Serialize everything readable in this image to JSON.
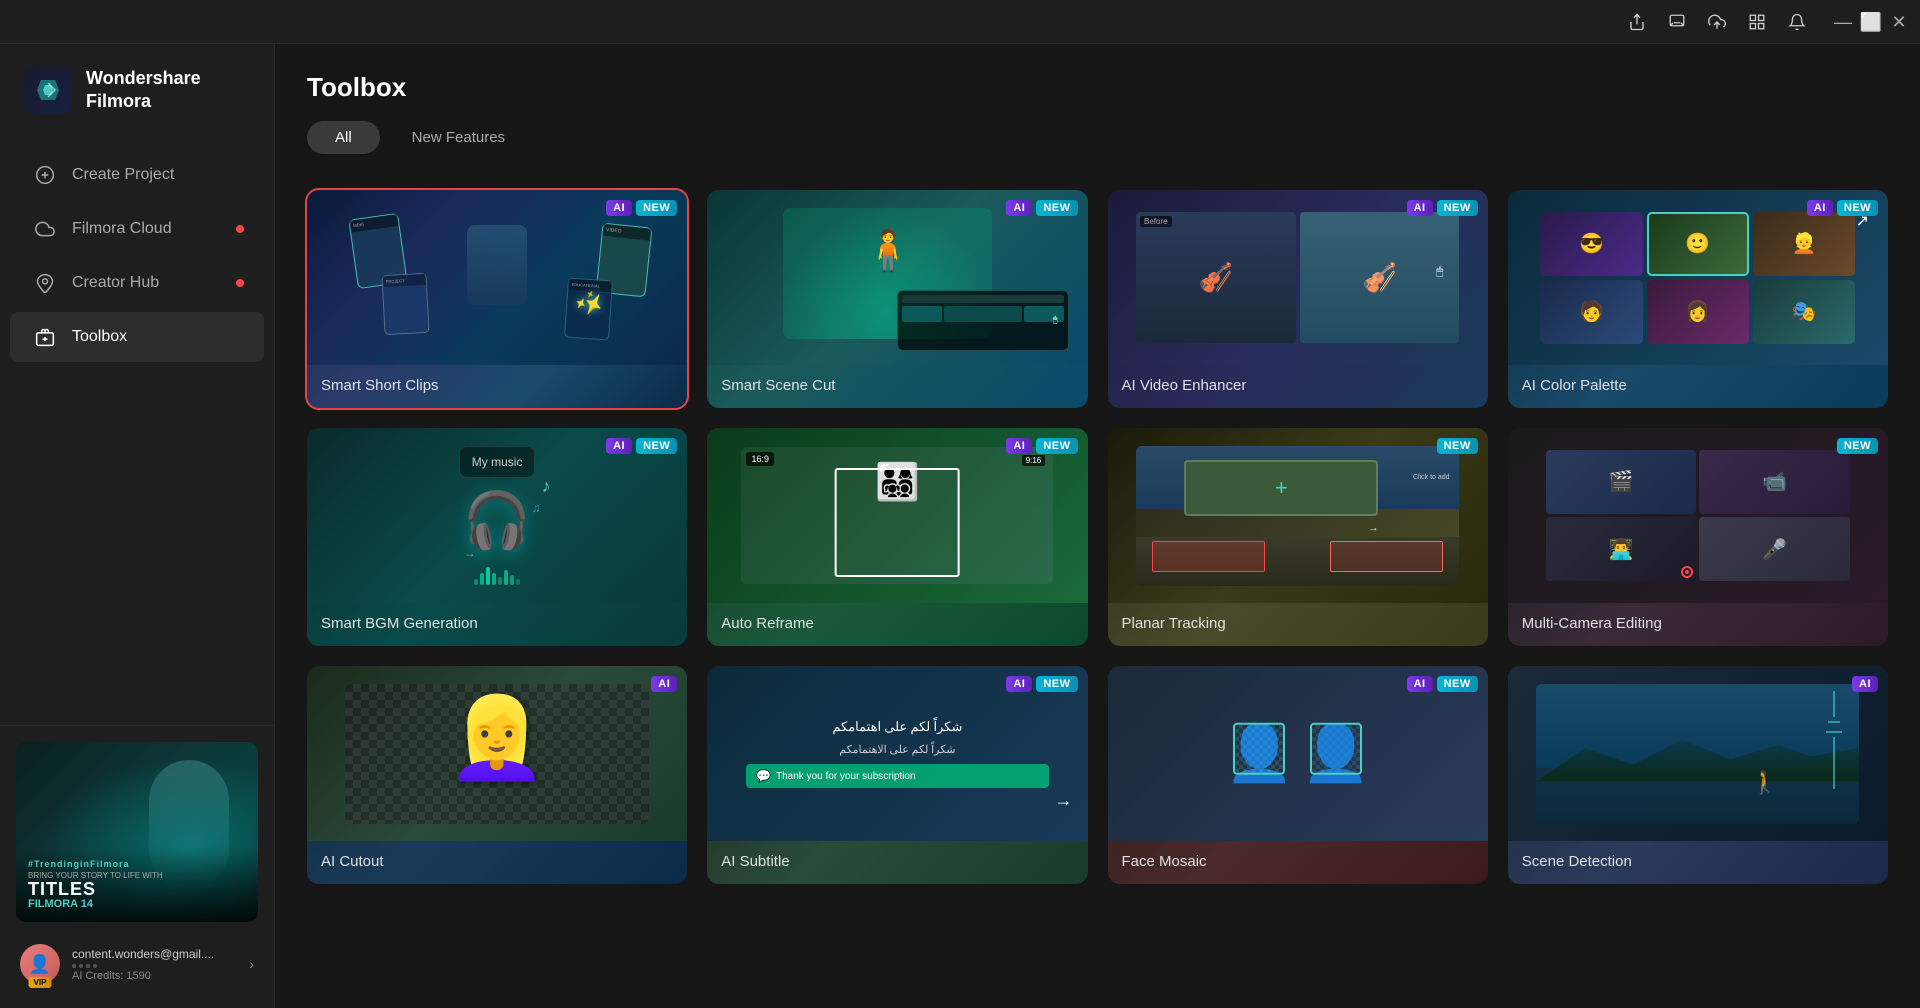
{
  "app": {
    "name": "Wondershare Filmora",
    "logo_text_line1": "Wondershare",
    "logo_text_line2": "Filmora"
  },
  "titlebar": {
    "icons": [
      "share",
      "feedback",
      "upload",
      "grid",
      "notifications",
      "minimize",
      "maximize",
      "close"
    ]
  },
  "sidebar": {
    "nav_items": [
      {
        "id": "create-project",
        "label": "Create Project",
        "icon": "➕",
        "active": false,
        "dot": false
      },
      {
        "id": "filmora-cloud",
        "label": "Filmora Cloud",
        "icon": "☁",
        "active": false,
        "dot": true
      },
      {
        "id": "creator-hub",
        "label": "Creator Hub",
        "icon": "📍",
        "active": false,
        "dot": true
      },
      {
        "id": "toolbox",
        "label": "Toolbox",
        "icon": "🧰",
        "active": true,
        "dot": false
      }
    ],
    "promo": {
      "tag": "#TrendinginFilmora",
      "subtitle": "BRING YOUR STORY TO LIFE WITH",
      "title": "TITLES",
      "label": "FILMORA 14"
    },
    "user": {
      "email": "content.wonders@gmail....",
      "credits_label": "AI Credits: 1590",
      "vip": "VIP"
    }
  },
  "content": {
    "title": "Toolbox",
    "tabs": [
      {
        "id": "all",
        "label": "All",
        "active": true
      },
      {
        "id": "new-features",
        "label": "New Features",
        "active": false
      }
    ],
    "tools": [
      {
        "id": "smart-short-clips",
        "name": "Smart Short Clips",
        "badges": [
          "AI",
          "NEW"
        ],
        "bg_class": "card-bg-1",
        "selected": true,
        "visual_type": "ssc"
      },
      {
        "id": "smart-scene-cut",
        "name": "Smart Scene Cut",
        "badges": [
          "AI",
          "NEW"
        ],
        "bg_class": "card-bg-2",
        "selected": false,
        "visual_type": "scene_cut"
      },
      {
        "id": "ai-video-enhancer",
        "name": "AI Video Enhancer",
        "badges": [
          "AI",
          "NEW"
        ],
        "bg_class": "card-bg-3",
        "selected": false,
        "visual_type": "aiv"
      },
      {
        "id": "ai-color-palette",
        "name": "AI Color Palette",
        "badges": [
          "AI",
          "NEW"
        ],
        "bg_class": "card-bg-4",
        "selected": false,
        "visual_type": "acp"
      },
      {
        "id": "smart-bgm-generation",
        "name": "Smart BGM Generation",
        "badges": [
          "AI",
          "NEW"
        ],
        "bg_class": "card-bg-5",
        "selected": false,
        "visual_type": "bgm"
      },
      {
        "id": "auto-reframe",
        "name": "Auto Reframe",
        "badges": [
          "AI",
          "NEW"
        ],
        "bg_class": "card-bg-6",
        "selected": false,
        "visual_type": "ar"
      },
      {
        "id": "planar-tracking",
        "name": "Planar Tracking",
        "badges": [
          "NEW"
        ],
        "bg_class": "card-bg-7",
        "selected": false,
        "visual_type": "pt"
      },
      {
        "id": "multi-camera-editing",
        "name": "Multi-Camera Editing",
        "badges": [
          "NEW"
        ],
        "bg_class": "card-bg-8",
        "selected": false,
        "visual_type": "mc"
      },
      {
        "id": "ai-cutout",
        "name": "AI Cutout",
        "badges": [
          "AI"
        ],
        "bg_class": "card-bg-9",
        "selected": false,
        "visual_type": "person"
      },
      {
        "id": "ai-subtitle",
        "name": "AI Subtitle",
        "badges": [
          "AI",
          "NEW"
        ],
        "bg_class": "card-bg-10",
        "selected": false,
        "visual_type": "subtitle"
      },
      {
        "id": "face-mosaic",
        "name": "Face Mosaic",
        "badges": [
          "AI",
          "NEW"
        ],
        "bg_class": "card-bg-11",
        "selected": false,
        "visual_type": "face"
      },
      {
        "id": "scene-detection",
        "name": "Scene Detection",
        "badges": [
          "AI"
        ],
        "bg_class": "card-bg-12",
        "selected": false,
        "visual_type": "scene_video"
      }
    ]
  }
}
